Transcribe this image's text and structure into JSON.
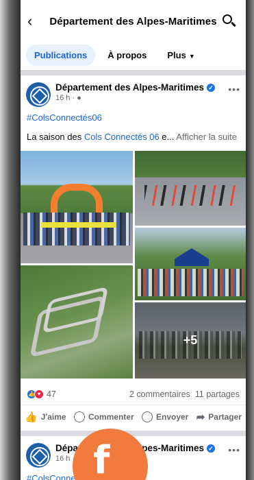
{
  "header": {
    "back_icon": "chevron-left-icon",
    "title": "Département des Alpes-Maritimes",
    "search_icon": "search-icon"
  },
  "tabs": [
    {
      "label": "Publications",
      "active": true
    },
    {
      "label": "À propos",
      "active": false
    },
    {
      "label": "Plus",
      "active": false,
      "icon": "caret-down-icon"
    }
  ],
  "post": {
    "author": "Département des Alpes-Maritimes",
    "verified_icon": "verified-badge-icon",
    "time": "16 h ·",
    "privacy_icon": "globe-icon",
    "more_icon": "more-dots-icon",
    "hashtag": "#ColsConnectés06",
    "text_prefix": "La saison des ",
    "text_link": "Cols Connectés 06",
    "text_suffix": " e...",
    "see_more": "Afficher la suite",
    "extra_photos": "+5",
    "reaction_count": "47",
    "comments": "2 commentaires",
    "shares": "11 partages",
    "actions": {
      "like": "J'aime",
      "comment": "Commenter",
      "send": "Envoyer",
      "share": "Partager"
    }
  },
  "post2": {
    "author": "Département des Alpes-Maritimes",
    "time": "16 h ·",
    "hashtag": "#ColsConnectés06"
  },
  "overlay": {
    "logo_letter": "f"
  },
  "colors": {
    "link": "#1b64d8",
    "verified": "#1b74e4",
    "overlay_orange": "#f27a3d"
  }
}
